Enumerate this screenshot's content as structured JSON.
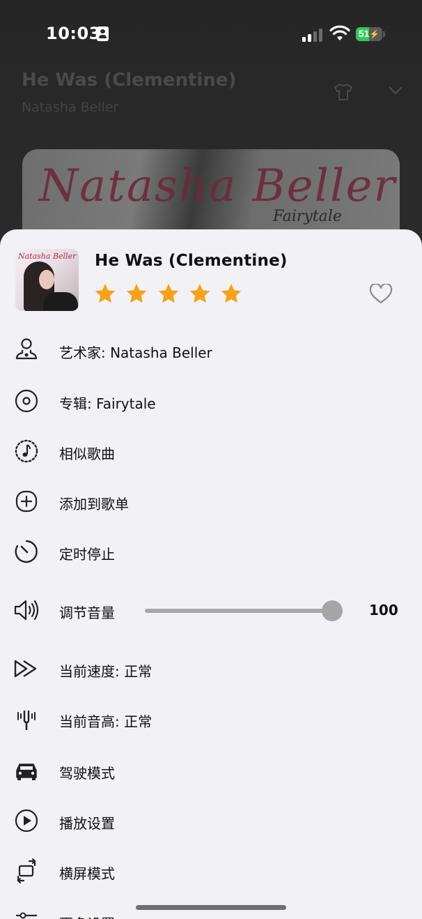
{
  "status_bar": {
    "time": "10:03",
    "battery": "51",
    "battery_level": 0.51,
    "colors": {
      "battery_fill": "#34c759"
    }
  },
  "player": {
    "title": "He Was (Clementine)",
    "artist": "Natasha Beller",
    "art_script": "Natasha Beller",
    "art_sub": "Fairytale"
  },
  "sheet": {
    "song_title": "He Was (Clementine)",
    "cover_script": "Natasha Beller",
    "rating": 5,
    "rating_max": 5,
    "accent_color": "#f7a21b",
    "items": [
      {
        "id": "artist",
        "label": "艺术家: Natasha Beller",
        "icon": "artist-icon"
      },
      {
        "id": "album",
        "label": "专辑: Fairytale",
        "icon": "album-disc-icon"
      },
      {
        "id": "similar",
        "label": "相似歌曲",
        "icon": "music-note-circle-icon"
      },
      {
        "id": "add-playlist",
        "label": "添加到歌单",
        "icon": "add-circle-icon"
      },
      {
        "id": "sleep-timer",
        "label": "定时停止",
        "icon": "timer-icon"
      },
      {
        "id": "volume",
        "label": "调节音量",
        "icon": "volume-icon"
      },
      {
        "id": "speed",
        "label": "当前速度: 正常",
        "icon": "fast-forward-icon"
      },
      {
        "id": "pitch",
        "label": "当前音高: 正常",
        "icon": "tuning-fork-icon"
      },
      {
        "id": "driving",
        "label": "驾驶模式",
        "icon": "car-icon"
      },
      {
        "id": "playback",
        "label": "播放设置",
        "icon": "play-circle-icon"
      },
      {
        "id": "landscape",
        "label": "横屏模式",
        "icon": "rotate-screen-icon"
      },
      {
        "id": "more",
        "label": "更多设置",
        "icon": "sliders-icon"
      }
    ],
    "volume": {
      "value": "100",
      "level": 0.96
    }
  }
}
